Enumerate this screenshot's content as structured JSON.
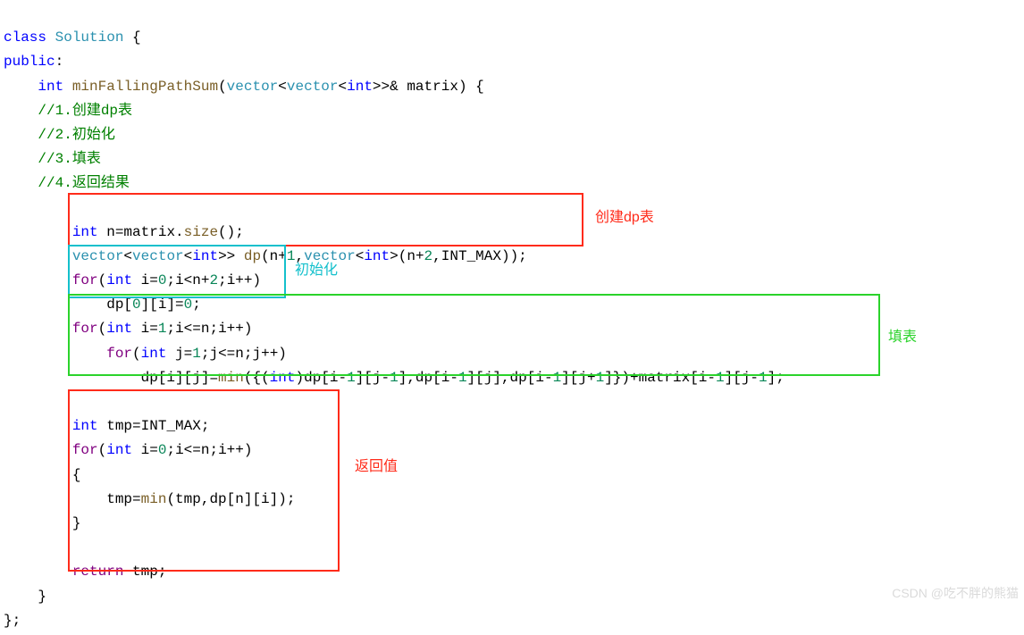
{
  "code": {
    "l1a": "class",
    "l1b": "Solution",
    "l1c": " {",
    "l2a": "public",
    "l2b": ":",
    "l3a": "int",
    "l3b": "minFallingPathSum",
    "l3c": "(",
    "l3d": "vector",
    "l3e": "<",
    "l3f": "vector",
    "l3g": "<",
    "l3h": "int",
    "l3i": ">>& ",
    "l3j": "matrix",
    "l3k": ") {",
    "l4": "//1.创建dp表",
    "l5": "//2.初始化",
    "l6": "//3.填表",
    "l7": "//4.返回结果",
    "l8a": "int",
    "l8b": " n=matrix.",
    "l8c": "size",
    "l8d": "();",
    "l9a": "vector",
    "l9b": "<",
    "l9c": "vector",
    "l9d": "<",
    "l9e": "int",
    "l9f": ">> ",
    "l9g": "dp",
    "l9h": "(n+",
    "l9i": "1",
    "l9j": ",",
    "l9k": "vector",
    "l9l": "<",
    "l9m": "int",
    "l9n": ">(n+",
    "l9o": "2",
    "l9p": ",INT_MAX));",
    "l10a": "for",
    "l10b": "(",
    "l10c": "int",
    "l10d": " i=",
    "l10e": "0",
    "l10f": ";i<n+",
    "l10g": "2",
    "l10h": ";i++)",
    "l11a": "dp[",
    "l11b": "0",
    "l11c": "][i]=",
    "l11d": "0",
    "l11e": ";",
    "l12a": "for",
    "l12b": "(",
    "l12c": "int",
    "l12d": " i=",
    "l12e": "1",
    "l12f": ";i<=n;i++)",
    "l13a": "for",
    "l13b": "(",
    "l13c": "int",
    "l13d": " j=",
    "l13e": "1",
    "l13f": ";j<=n;j++)",
    "l14a": "dp[i][j]=",
    "l14b": "min",
    "l14c": "({(",
    "l14d": "int",
    "l14e": ")dp[i-",
    "l14f": "1",
    "l14g": "][j-",
    "l14h": "1",
    "l14i": "],dp[i-",
    "l14j": "1",
    "l14k": "][j],dp[i-",
    "l14l": "1",
    "l14m": "][j+",
    "l14n": "1",
    "l14o": "]})+matrix[i-",
    "l14p": "1",
    "l14q": "][j-",
    "l14r": "1",
    "l14s": "];",
    "l15a": "int",
    "l15b": " tmp=INT_MAX;",
    "l16a": "for",
    "l16b": "(",
    "l16c": "int",
    "l16d": " i=",
    "l16e": "0",
    "l16f": ";i<=n;i++)",
    "l17": "{",
    "l18a": "tmp=",
    "l18b": "min",
    "l18c": "(tmp,dp[n][i]);",
    "l19": "}",
    "l20a": "return",
    "l20b": " tmp;",
    "l21": "}",
    "l22": "};"
  },
  "labels": {
    "create": "创建dp表",
    "init": "初始化",
    "fill": "填表",
    "ret": "返回值"
  },
  "watermark": "CSDN @吃不胖的熊猫"
}
